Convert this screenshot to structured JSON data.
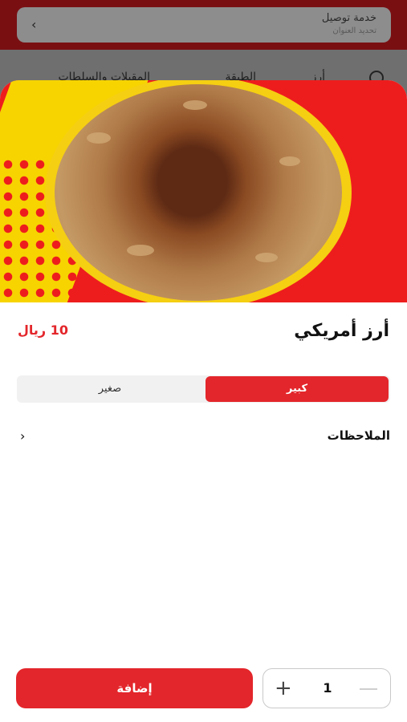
{
  "background": {
    "delivery_title": "خدمة توصيل",
    "delivery_subtitle": "تحديد العنوان",
    "nav_items": [
      "أرز",
      "الطبقة",
      "المقبلات والسلطات"
    ]
  },
  "hero": {
    "image": "american-rice-dish-image"
  },
  "product": {
    "name": "أرز أمريكي",
    "price": "10 ريال"
  },
  "size_options": {
    "selected": "كبير",
    "other": "صغير"
  },
  "notes": {
    "label": "الملاحظات"
  },
  "footer": {
    "add_label": "إضافة",
    "quantity": "1"
  },
  "colors": {
    "accent": "#e3262b",
    "hero_bg": "#ee1d1d",
    "hero_yellow": "#f7d400"
  }
}
